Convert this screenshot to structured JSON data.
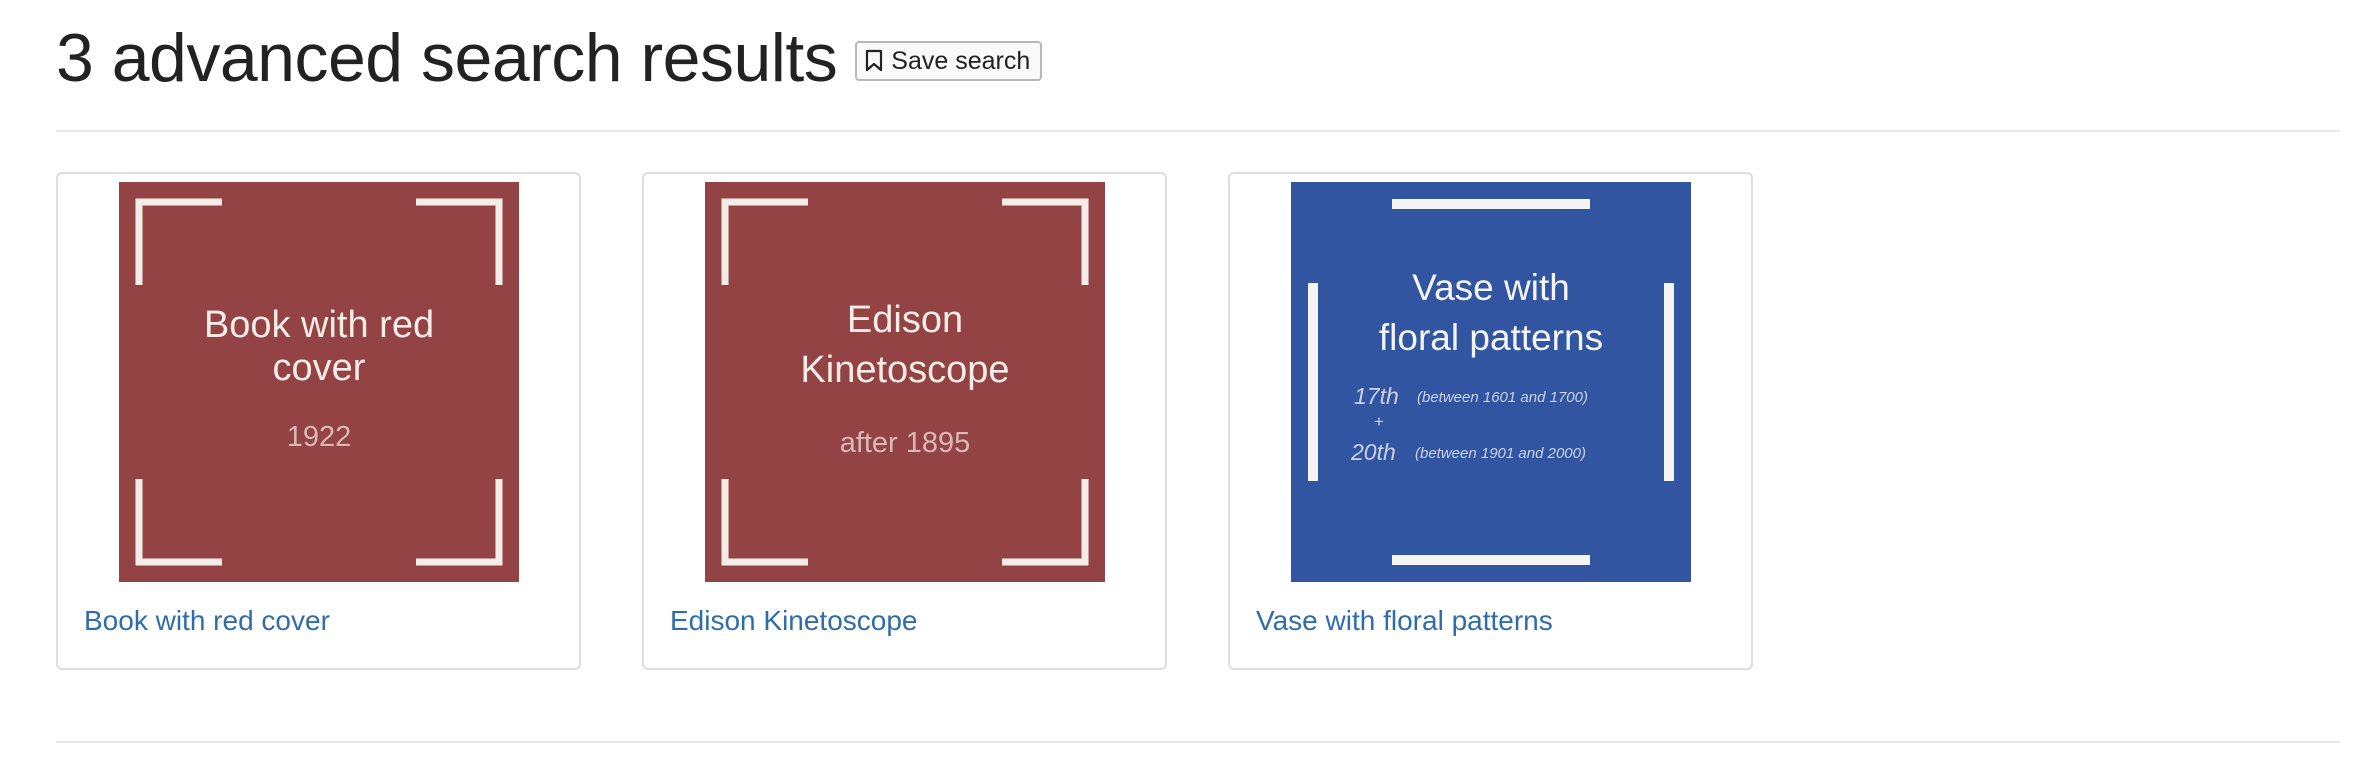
{
  "header": {
    "title": "3 advanced search results",
    "save_button_label": "Save search",
    "save_icon": "bookmark-icon"
  },
  "results": [
    {
      "link_text": "Book with red cover",
      "thumbnail": {
        "bg_color": "#934343",
        "title_line_1": "Book with red",
        "title_line_2": "cover",
        "date": "1922"
      }
    },
    {
      "link_text": "Edison Kinetoscope",
      "thumbnail": {
        "bg_color": "#934343",
        "title_line_1": "Edison",
        "title_line_2": "Kinetoscope",
        "date": "after 1895"
      }
    },
    {
      "link_text": "Vase with floral patterns",
      "thumbnail": {
        "bg_color": "#3155a0",
        "title_line_1": "Vase with",
        "title_line_2": "floral patterns",
        "century_1": "17th",
        "range_1": "(between 1601 and 1700)",
        "plus": "+",
        "century_2": "20th",
        "range_2": "(between 1901 and 2000)"
      }
    }
  ],
  "colors": {
    "link": "#2f6da8",
    "frame_marks": "#f4ece6",
    "red_placeholder": "#934343",
    "blue_placeholder": "#3155a0"
  }
}
